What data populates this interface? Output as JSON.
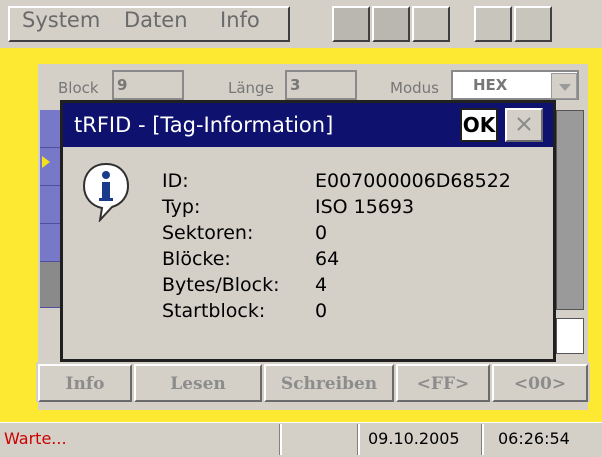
{
  "menu": {
    "items": [
      "System",
      "Daten",
      "Info"
    ]
  },
  "toolbar": {
    "buttons": [
      "pressed-1",
      "pressed-2",
      "button-3",
      "button-4",
      "button-5"
    ]
  },
  "fields": {
    "block_label": "Block",
    "block_value": "9",
    "length_label": "Länge",
    "length_value": "3",
    "mode_label": "Modus",
    "mode_value": "HEX"
  },
  "dialog": {
    "title": "tRFID - [Tag-Information]",
    "ok_label": "OK",
    "close_label": "×",
    "icon": "info-icon",
    "rows": [
      {
        "label": "ID:",
        "value": "E007000006D68522"
      },
      {
        "label": "Typ:",
        "value": "ISO 15693"
      },
      {
        "label": "Sektoren:",
        "value": "0"
      },
      {
        "label": "Blöcke:",
        "value": "64"
      },
      {
        "label": "Bytes/Block:",
        "value": "4"
      },
      {
        "label": "Startblock:",
        "value": "0"
      }
    ]
  },
  "buttons": [
    "Info",
    "Lesen",
    "Schreiben",
    "<FF>",
    "<00>"
  ],
  "status": {
    "message": "Warte...",
    "date": "09.10.2005",
    "time": "06:26:54"
  },
  "colors": {
    "title_bar": "#0e126e",
    "accent_yellow": "#fde832",
    "status_red": "#cc0000",
    "grid_blue": "#7878c8"
  }
}
